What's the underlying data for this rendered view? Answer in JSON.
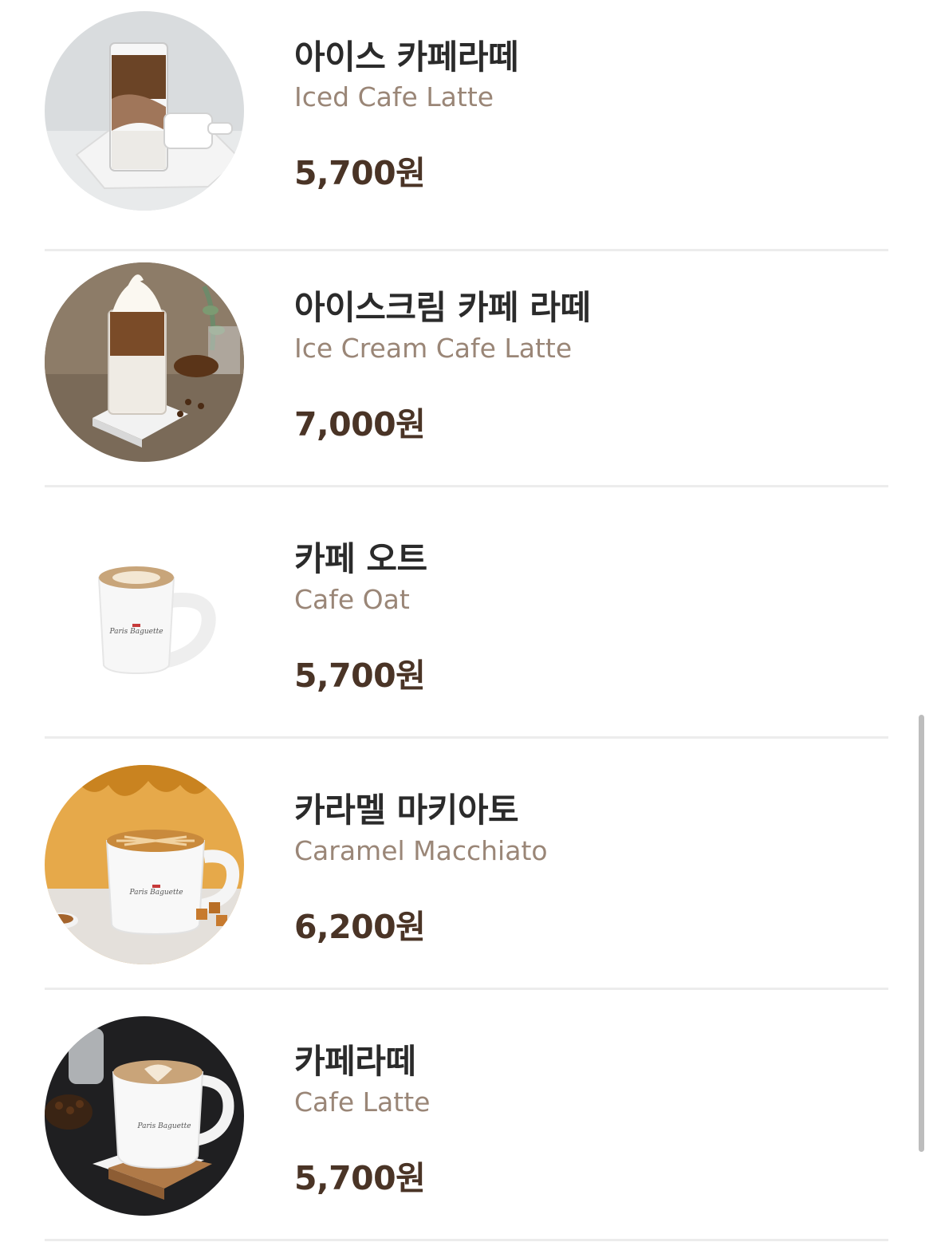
{
  "menu": {
    "items": [
      {
        "name_ko": "아이스 카페라떼",
        "name_en": "Iced Cafe Latte",
        "price": "5,700원",
        "image": "iced-latte-photo"
      },
      {
        "name_ko": "아이스크림 카페 라떼",
        "name_en": "Ice Cream Cafe Latte",
        "price": "7,000원",
        "image": "ice-cream-latte-photo"
      },
      {
        "name_ko": "카페 오트",
        "name_en": "Cafe Oat",
        "price": "5,700원",
        "image": "cafe-oat-mug-photo"
      },
      {
        "name_ko": "카라멜 마키아토",
        "name_en": "Caramel Macchiato",
        "price": "6,200원",
        "image": "caramel-macchiato-photo"
      },
      {
        "name_ko": "카페라떼",
        "name_en": "Cafe Latte",
        "price": "5,700원",
        "image": "cafe-latte-photo"
      }
    ]
  },
  "colors": {
    "title": "#2b2b2b",
    "subtitle": "#9a8677",
    "price": "#4a3426",
    "divider": "#ececec"
  }
}
